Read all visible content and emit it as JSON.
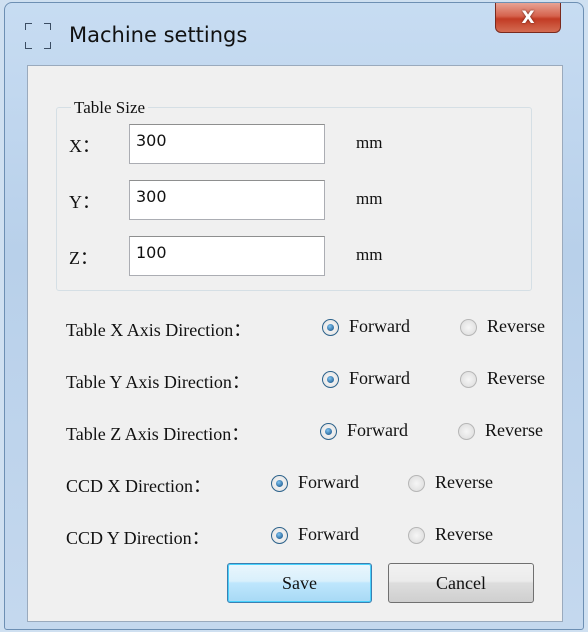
{
  "window": {
    "title": "Machine settings",
    "close_glyph": "X"
  },
  "table_size": {
    "legend": "Table Size",
    "fields": [
      {
        "label": "X：",
        "value": "300",
        "unit": "mm"
      },
      {
        "label": "Y：",
        "value": "300",
        "unit": "mm"
      },
      {
        "label": "Z：",
        "value": "100",
        "unit": "mm"
      }
    ]
  },
  "directions": [
    {
      "label": "Table X Axis Direction：",
      "selected": "Forward"
    },
    {
      "label": "Table Y Axis Direction：",
      "selected": "Forward"
    },
    {
      "label": "Table Z Axis Direction：",
      "selected": "Forward"
    },
    {
      "label": "CCD X Direction：",
      "selected": "Forward"
    },
    {
      "label": "CCD Y Direction：",
      "selected": "Forward"
    }
  ],
  "options": {
    "forward": "Forward",
    "reverse": "Reverse"
  },
  "buttons": {
    "save": "Save",
    "cancel": "Cancel"
  },
  "colors": {
    "titlebar": "#c7dcf2",
    "close": "#c23b24",
    "client": "#f0f0f0",
    "radio_checked": "#1f5a8e",
    "default_button_border": "#3c7fb1"
  }
}
